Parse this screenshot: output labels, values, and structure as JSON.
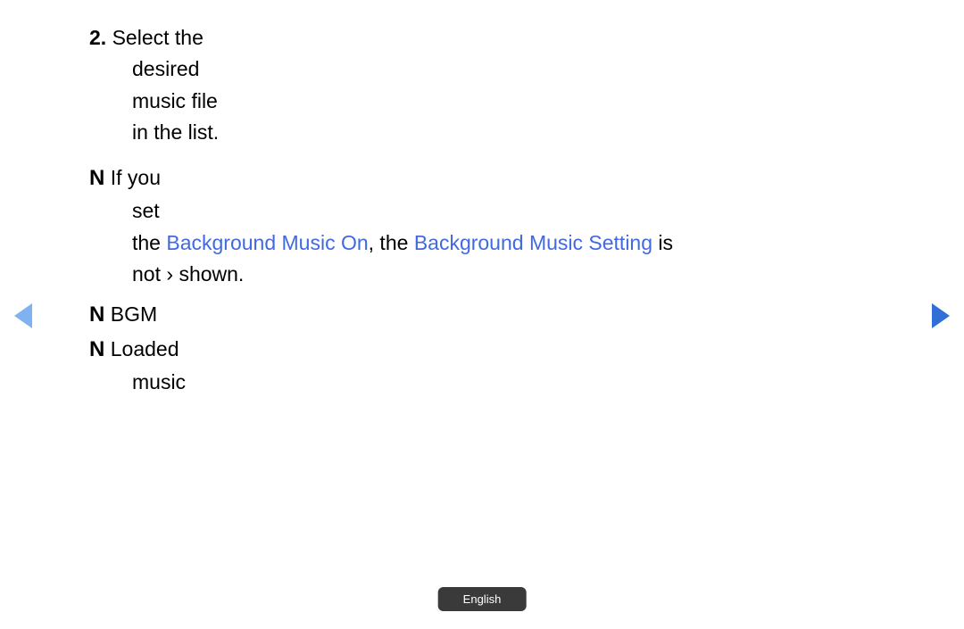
{
  "step": {
    "number": "2.",
    "line1_prefix": " Select ",
    "line1_end": "the ",
    "line2": "desired ",
    "line3": "music file",
    "line4": "in the list."
  },
  "note1": {
    "letter": "N",
    "prefix": " If ",
    "line1_end": "you ",
    "line2": "set ",
    "line3_indent": "the",
    "bgm_on": "Background Music On",
    "and": ", the",
    "bgm_setting": "Background Music Setting",
    "line4_after": " is ",
    "line5_prefix": "not",
    "line5_arrow": " › ",
    "line5_suffix": "shown",
    "line5_end": "."
  },
  "note2": {
    "letter": "N",
    "prefix": " BGM ",
    "line1_end": " "
  },
  "note3": {
    "letter": "N",
    "prefix": " Loaded",
    "line1_end": " ",
    "line2": "music"
  },
  "footer": {
    "language": "English"
  }
}
